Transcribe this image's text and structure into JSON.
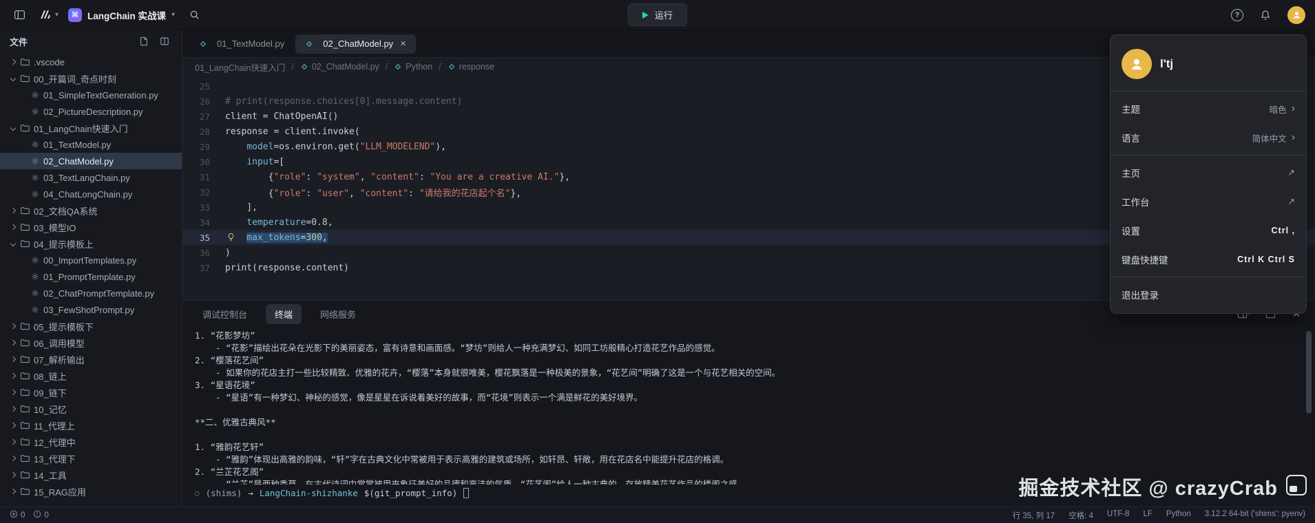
{
  "colors": {
    "avatar-yellow": "#e8b84b",
    "run-accent": "#2fd0a0",
    "string": "#cf7a68",
    "param": "#7ab6d9",
    "number": "#b5cea8",
    "comment": "#5d6571",
    "selection": "#2a486b",
    "project-gradient-start": "#5a7bfa",
    "project-gradient-end": "#9a5ef5"
  },
  "topbar": {
    "project_name": "LangChain 实战课",
    "run_label": "运行"
  },
  "sidebar": {
    "title": "文件",
    "tree": [
      {
        "label": ".vscode",
        "type": "folder",
        "depth": 0,
        "expanded": false
      },
      {
        "label": "00_开篇词_奇点时刻",
        "type": "folder",
        "depth": 0,
        "expanded": true
      },
      {
        "label": "01_SimpleTextGeneration.py",
        "type": "file",
        "depth": 1
      },
      {
        "label": "02_PictureDescription.py",
        "type": "file",
        "depth": 1
      },
      {
        "label": "01_LangChain快速入门",
        "type": "folder",
        "depth": 0,
        "expanded": true
      },
      {
        "label": "01_TextModel.py",
        "type": "file",
        "depth": 1
      },
      {
        "label": "02_ChatModel.py",
        "type": "file",
        "depth": 1,
        "selected": true
      },
      {
        "label": "03_TextLangChain.py",
        "type": "file",
        "depth": 1
      },
      {
        "label": "04_ChatLongChain.py",
        "type": "file",
        "depth": 1
      },
      {
        "label": "02_文档QA系统",
        "type": "folder",
        "depth": 0,
        "expanded": false
      },
      {
        "label": "03_模型IO",
        "type": "folder",
        "depth": 0,
        "expanded": false
      },
      {
        "label": "04_提示模板上",
        "type": "folder",
        "depth": 0,
        "expanded": true
      },
      {
        "label": "00_ImportTemplates.py",
        "type": "file",
        "depth": 1
      },
      {
        "label": "01_PromptTemplate.py",
        "type": "file",
        "depth": 1
      },
      {
        "label": "02_ChatPromptTemplate.py",
        "type": "file",
        "depth": 1
      },
      {
        "label": "03_FewShotPrompt.py",
        "type": "file",
        "depth": 1
      },
      {
        "label": "05_提示模板下",
        "type": "folder",
        "depth": 0,
        "expanded": false
      },
      {
        "label": "06_调用模型",
        "type": "folder",
        "depth": 0,
        "expanded": false
      },
      {
        "label": "07_解析输出",
        "type": "folder",
        "depth": 0,
        "expanded": false
      },
      {
        "label": "08_链上",
        "type": "folder",
        "depth": 0,
        "expanded": false
      },
      {
        "label": "09_链下",
        "type": "folder",
        "depth": 0,
        "expanded": false
      },
      {
        "label": "10_记忆",
        "type": "folder",
        "depth": 0,
        "expanded": false
      },
      {
        "label": "11_代理上",
        "type": "folder",
        "depth": 0,
        "expanded": false
      },
      {
        "label": "12_代理中",
        "type": "folder",
        "depth": 0,
        "expanded": false
      },
      {
        "label": "13_代理下",
        "type": "folder",
        "depth": 0,
        "expanded": false
      },
      {
        "label": "14_工具",
        "type": "folder",
        "depth": 0,
        "expanded": false
      },
      {
        "label": "15_RAG应用",
        "type": "folder",
        "depth": 0,
        "expanded": false
      }
    ]
  },
  "tabs": [
    {
      "label": "01_TextModel.py",
      "active": false
    },
    {
      "label": "02_ChatModel.py",
      "active": true
    }
  ],
  "breadcrumb": [
    {
      "label": "01_LangChain快速入门",
      "icon": false
    },
    {
      "label": "02_ChatModel.py",
      "icon": true
    },
    {
      "label": "Python",
      "icon": true
    },
    {
      "label": "response",
      "icon": true
    }
  ],
  "editor": {
    "lines": [
      {
        "num": "25",
        "tokens": []
      },
      {
        "num": "26",
        "tokens": [
          {
            "c": "cm",
            "t": "# print(response.choices[0].message.content)"
          }
        ]
      },
      {
        "num": "27",
        "tokens": [
          {
            "c": "d",
            "t": "client = ChatOpenAI()"
          }
        ]
      },
      {
        "num": "28",
        "tokens": [
          {
            "c": "d",
            "t": "response = client.invoke("
          }
        ]
      },
      {
        "num": "29",
        "tokens": [
          {
            "c": "d",
            "t": "    "
          },
          {
            "c": "p",
            "t": "model"
          },
          {
            "c": "d",
            "t": "=os.environ.get("
          },
          {
            "c": "s",
            "t": "\"LLM_MODELEND\""
          },
          {
            "c": "d",
            "t": "),"
          }
        ]
      },
      {
        "num": "30",
        "tokens": [
          {
            "c": "d",
            "t": "    "
          },
          {
            "c": "p",
            "t": "input"
          },
          {
            "c": "d",
            "t": "=["
          }
        ]
      },
      {
        "num": "31",
        "tokens": [
          {
            "c": "d",
            "t": "        {"
          },
          {
            "c": "s",
            "t": "\"role\""
          },
          {
            "c": "d",
            "t": ": "
          },
          {
            "c": "s",
            "t": "\"system\""
          },
          {
            "c": "d",
            "t": ", "
          },
          {
            "c": "s",
            "t": "\"content\""
          },
          {
            "c": "d",
            "t": ": "
          },
          {
            "c": "s",
            "t": "\"You are a creative AI.\""
          },
          {
            "c": "d",
            "t": "},"
          }
        ]
      },
      {
        "num": "32",
        "tokens": [
          {
            "c": "d",
            "t": "        {"
          },
          {
            "c": "s",
            "t": "\"role\""
          },
          {
            "c": "d",
            "t": ": "
          },
          {
            "c": "s",
            "t": "\"user\""
          },
          {
            "c": "d",
            "t": ", "
          },
          {
            "c": "s",
            "t": "\"content\""
          },
          {
            "c": "d",
            "t": ": "
          },
          {
            "c": "s",
            "t": "\"请给我的花店起个名\""
          },
          {
            "c": "d",
            "t": "},"
          }
        ]
      },
      {
        "num": "33",
        "tokens": [
          {
            "c": "d",
            "t": "    ],"
          }
        ]
      },
      {
        "num": "34",
        "tokens": [
          {
            "c": "d",
            "t": "    "
          },
          {
            "c": "p",
            "t": "temperature"
          },
          {
            "c": "d",
            "t": "="
          },
          {
            "c": "n",
            "t": "0.8"
          },
          {
            "c": "d",
            "t": ","
          }
        ]
      },
      {
        "num": "35",
        "current": true,
        "tokens": [
          {
            "c": "d",
            "t": "    "
          },
          {
            "c": "p",
            "t": "max_tokens",
            "sel": true
          },
          {
            "c": "d",
            "t": "=",
            "sel": true
          },
          {
            "c": "n",
            "t": "300",
            "sel": true
          },
          {
            "c": "d",
            "t": ",",
            "sel": true
          }
        ]
      },
      {
        "num": "36",
        "tokens": [
          {
            "c": "d",
            "t": ")"
          }
        ]
      },
      {
        "num": "37",
        "tokens": [
          {
            "c": "d",
            "t": "print(response.content)"
          }
        ]
      }
    ]
  },
  "panel": {
    "tabs": [
      {
        "name": "debug-console",
        "label": "调试控制台",
        "active": false
      },
      {
        "name": "terminal",
        "label": "终端",
        "active": true
      },
      {
        "name": "network-service",
        "label": "网络服务",
        "active": false
      }
    ],
    "terminal_lines": [
      "1. “花影梦坊”",
      "    - “花影”描绘出花朵在光影下的美丽姿态，富有诗意和画面感。“梦坊”则给人一种充满梦幻、如同工坊般精心打造花艺作品的感觉。",
      "2. “樱落花艺间”",
      "    - 如果你的花店主打一些比较精致、优雅的花卉，“樱落”本身就很唯美，樱花飘落是一种极美的景象，“花艺间”明确了这是一个与花艺相关的空间。",
      "3. “星语花境”",
      "    - “星语”有一种梦幻、神秘的感觉，像是星星在诉说着美好的故事，而“花境”则表示一个满是鲜花的美好境界。",
      "",
      "**二、优雅古典风**",
      "",
      "1. “雅韵花艺轩”",
      "    - “雅韵”体现出高雅的韵味，“轩”字在古典文化中常被用于表示高雅的建筑或场所，如轩昂、轩敞，用在花店名中能提升花店的格调。",
      "2. “兰芷花艺阁”",
      "    - “兰芷”是两种香草，在古代诗词中常常被用来象征美好的品德和高洁的气质，“花艺阁”给人一种古典的、存放精美花艺作品的楼阁之感。"
    ],
    "prompt": {
      "status": "○",
      "venv": "(shims)",
      "arrow": "→",
      "dir": "LangChain-shizhanke",
      "cmd": "$(git_prompt_info)"
    }
  },
  "user_menu": {
    "username": "l'tj",
    "items": [
      {
        "type": "value",
        "name": "theme",
        "label": "主题",
        "value": "暗色"
      },
      {
        "type": "value",
        "name": "language",
        "label": "语言",
        "value": "简体中文"
      },
      {
        "type": "divider"
      },
      {
        "type": "link",
        "name": "home",
        "label": "主页"
      },
      {
        "type": "link",
        "name": "workbench",
        "label": "工作台"
      },
      {
        "type": "keys",
        "name": "settings",
        "label": "设置",
        "keys": "Ctrl ,"
      },
      {
        "type": "keys",
        "name": "keyboard-shortcuts",
        "label": "键盘快捷键",
        "keys": "Ctrl K Ctrl S"
      },
      {
        "type": "divider"
      },
      {
        "type": "plain",
        "name": "logout",
        "label": "退出登录"
      }
    ]
  },
  "status_bar": {
    "problems": [
      {
        "icon": "error-circle",
        "count": "0"
      },
      {
        "icon": "warning-circle",
        "count": "0"
      }
    ],
    "items": [
      {
        "name": "cursor-position",
        "label": "行 35, 列 17"
      },
      {
        "name": "indentation",
        "label": "空格: 4"
      },
      {
        "name": "encoding",
        "label": "UTF-8"
      },
      {
        "name": "eol",
        "label": "LF"
      },
      {
        "name": "language-mode",
        "label": "Python"
      },
      {
        "name": "python-interpreter",
        "label": "3.12.2 64-bit ('shims': pyenv)"
      }
    ]
  },
  "watermark": {
    "text": "掘金技术社区 @ crazyCrab"
  }
}
